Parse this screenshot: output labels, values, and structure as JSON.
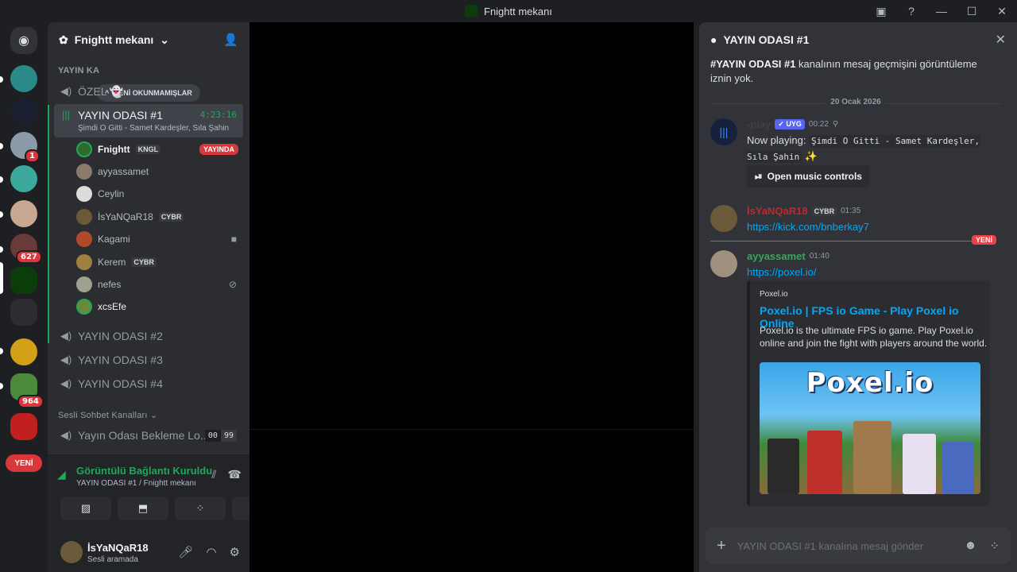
{
  "window": {
    "title": "Fnightt mekanı"
  },
  "server_rail": {
    "badges": [
      "1",
      "627",
      "964"
    ],
    "new_label": "YENİ"
  },
  "sidebar": {
    "guild_name": "Fnightt mekanı",
    "category_top": "YAYIN KA",
    "unread_pill": "YENİ OKUNMAMIŞLAR",
    "channels": {
      "ozel": "ÖZEL 👻",
      "active": {
        "name": "YAYIN ODASI #1",
        "time": "4:23:16",
        "activity": "Şimdi O Gitti - Samet Kardeşler, Sıla Şahin"
      },
      "oda2": "YAYIN ODASI #2",
      "oda3": "YAYIN ODASI #3",
      "oda4": "YAYIN ODASI #4"
    },
    "members": [
      {
        "name": "Fnightt",
        "tag": "KNGL",
        "live": "YAYINDA"
      },
      {
        "name": "ayyassamet"
      },
      {
        "name": "Ceylin"
      },
      {
        "name": "İsYaNQaR18",
        "tag": "CYBR"
      },
      {
        "name": "Kagami"
      },
      {
        "name": "Kerem",
        "tag": "CYBR"
      },
      {
        "name": "nefes"
      },
      {
        "name": "xcsEfe"
      }
    ],
    "category_voice": "Sesli Sohbet Kanalları",
    "waiting": {
      "name": "Yayın Odası Bekleme Lo...",
      "count_a": "00",
      "count_b": "99"
    }
  },
  "voice_panel": {
    "title": "Görüntülü Bağlantı Kuruldu",
    "subtitle": "YAYIN ODASI #1 / Fnightt mekanı"
  },
  "user_panel": {
    "name": "İsYaNQaR18",
    "status": "Sesli aramada"
  },
  "chat": {
    "header": "YAYIN ODASI #1",
    "no_permission_channel": "#YAYIN ODASI #1",
    "no_permission_text": " kanalının mesaj geçmişini görüntüleme iznin yok.",
    "date_divider": "20 Ocak 2026",
    "messages": [
      {
        "author": "-play",
        "bot_tag": "✓ UYG",
        "time": "00:22",
        "body_prefix": "Now playing: ",
        "song": "Şimdi O Gitti - Samet Kardeşler, Sıla Şahin",
        "emoji": "✨",
        "button": "Open music controls"
      },
      {
        "author": "İsYaNQaR18",
        "role": "CYBR",
        "time": "01:35",
        "link": "https://kick.com/bnberkay7"
      },
      {
        "author": "ayyassamet",
        "time": "01:40",
        "link": "https://poxel.io/",
        "embed": {
          "provider": "Poxel.io",
          "title": "Poxel.io | FPS io Game - Play Poxel io Online",
          "description": "Poxel.io is the ultimate FPS io game. Play Poxel.io online and join the fight with players around the world.",
          "image_text": "Poxel.io"
        }
      }
    ],
    "new_label": "YENİ",
    "input_placeholder": "YAYIN ODASI #1 kanalına mesaj gönder"
  }
}
